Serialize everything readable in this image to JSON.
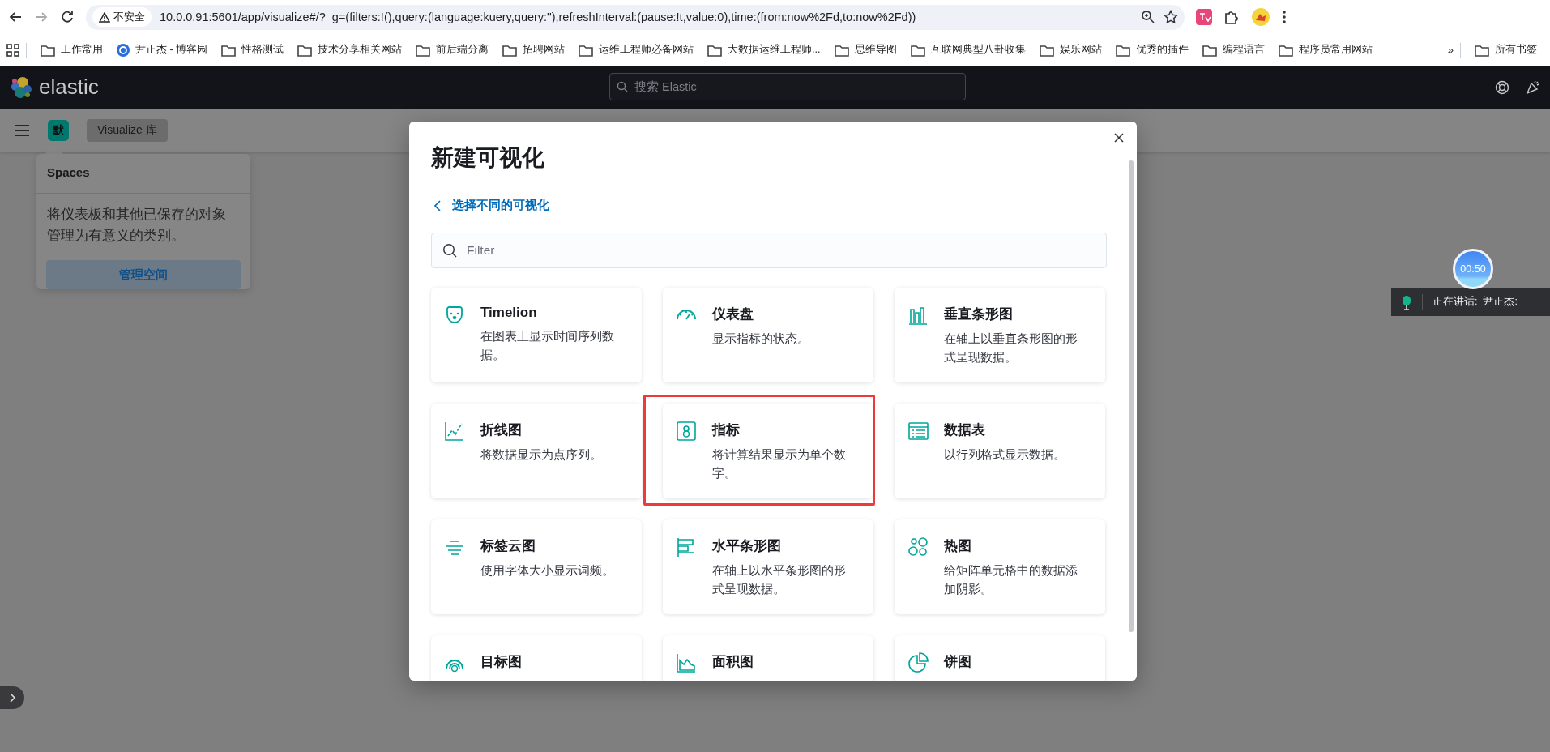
{
  "browser": {
    "security_label": "不安全",
    "url": "10.0.0.91:5601/app/visualize#/?_g=(filters:!(),query:(language:kuery,query:''),refreshInterval:(pause:!t,value:0),time:(from:now%2Fd,to:now%2Fd))",
    "bookmarks": [
      {
        "label": "工作常用",
        "kind": "folder"
      },
      {
        "label": "尹正杰 - 博客园",
        "kind": "site"
      },
      {
        "label": "性格测试",
        "kind": "folder"
      },
      {
        "label": "技术分享相关网站",
        "kind": "folder"
      },
      {
        "label": "前后端分离",
        "kind": "folder"
      },
      {
        "label": "招聘网站",
        "kind": "folder"
      },
      {
        "label": "运维工程师必备网站",
        "kind": "folder"
      },
      {
        "label": "大数据运维工程师...",
        "kind": "folder"
      },
      {
        "label": "思维导图",
        "kind": "folder"
      },
      {
        "label": "互联网典型八卦收集",
        "kind": "folder"
      },
      {
        "label": "娱乐网站",
        "kind": "folder"
      },
      {
        "label": "优秀的插件",
        "kind": "folder"
      },
      {
        "label": "编程语言",
        "kind": "folder"
      },
      {
        "label": "程序员常用网站",
        "kind": "folder"
      }
    ],
    "overflow": "»",
    "all_bookmarks": "所有书签"
  },
  "header": {
    "brand": "elastic",
    "search": {
      "placeholder": "搜索 Elastic"
    }
  },
  "subheader": {
    "space_avatar": "默",
    "breadcrumb": "Visualize 库"
  },
  "spaces_popover": {
    "title": "Spaces",
    "description": "将仪表板和其他已保存的对象管理为有意义的类别。",
    "button": "管理空间"
  },
  "modal": {
    "title": "新建可视化",
    "back_link": "选择不同的可视化",
    "filter": {
      "placeholder": "Filter"
    },
    "cards": [
      {
        "kind": "timelion",
        "title": "Timelion",
        "description": "在图表上显示时间序列数据。",
        "highlighted": false
      },
      {
        "kind": "gauge",
        "title": "仪表盘",
        "description": "显示指标的状态。",
        "highlighted": false
      },
      {
        "kind": "vbar",
        "title": "垂直条形图",
        "description": "在轴上以垂直条形图的形式呈现数据。",
        "highlighted": false
      },
      {
        "kind": "line",
        "title": "折线图",
        "description": "将数据显示为点序列。",
        "highlighted": false
      },
      {
        "kind": "metric",
        "title": "指标",
        "description": "将计算结果显示为单个数字。",
        "highlighted": true
      },
      {
        "kind": "table",
        "title": "数据表",
        "description": "以行列格式显示数据。",
        "highlighted": false
      },
      {
        "kind": "tagcloud",
        "title": "标签云图",
        "description": "使用字体大小显示词频。",
        "highlighted": false
      },
      {
        "kind": "hbar",
        "title": "水平条形图",
        "description": "在轴上以水平条形图的形式呈现数据。",
        "highlighted": false
      },
      {
        "kind": "heatmap",
        "title": "热图",
        "description": "给矩阵单元格中的数据添加阴影。",
        "highlighted": false
      },
      {
        "kind": "goal",
        "title": "目标图",
        "highlighted": false
      },
      {
        "kind": "area",
        "title": "面积图",
        "highlighted": false
      },
      {
        "kind": "pie",
        "title": "饼图",
        "highlighted": false
      }
    ]
  },
  "recording": {
    "timer": "00:50",
    "speaking": "正在讲话:  尹正杰:"
  }
}
